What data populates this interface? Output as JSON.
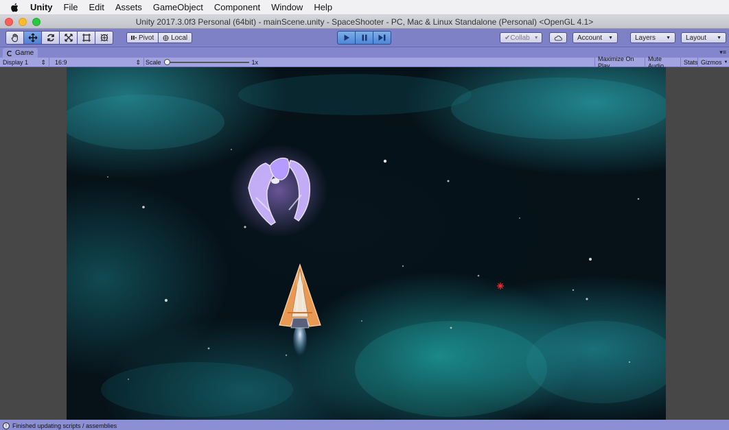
{
  "menubar": {
    "app": "Unity",
    "items": [
      "File",
      "Edit",
      "Assets",
      "GameObject",
      "Component",
      "Window",
      "Help"
    ]
  },
  "window": {
    "title": "Unity 2017.3.0f3 Personal (64bit) - mainScene.unity - SpaceShooter - PC, Mac & Linux Standalone (Personal) <OpenGL 4.1>"
  },
  "toolbar": {
    "pivot_label": "Pivot",
    "local_label": "Local",
    "collab_label": "Collab",
    "account_label": "Account",
    "layers_label": "Layers",
    "layout_label": "Layout"
  },
  "game": {
    "tab_label": "Game",
    "display": "Display 1",
    "aspect": "16:9",
    "scale_label": "Scale",
    "scale_value": "1x",
    "maximize_label": "Maximize On Play",
    "mute_label": "Mute Audio",
    "stats_label": "Stats",
    "gizmos_label": "Gizmos"
  },
  "status": {
    "message": "Finished updating scripts / assemblies"
  },
  "colors": {
    "editor_tint": "#8d8fd4",
    "play_active": "#4d86d8",
    "nebula": "#1fa6a8"
  }
}
